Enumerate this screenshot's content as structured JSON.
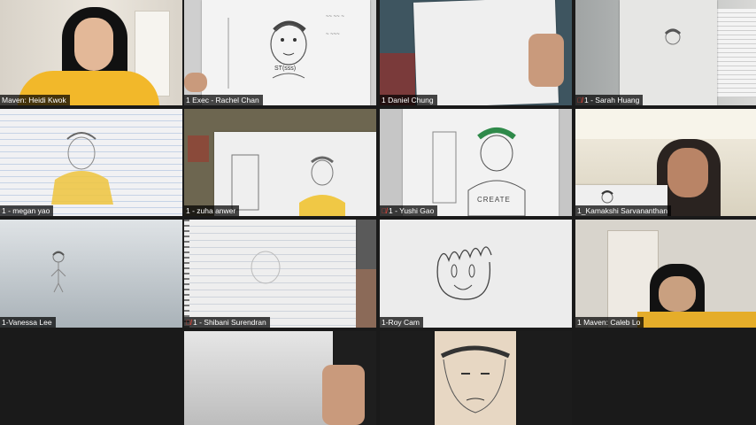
{
  "participants": [
    {
      "name": "Maven: Heidi Kwok",
      "muted": false,
      "active_speaker": true
    },
    {
      "name": "1 Exec - Rachel Chan",
      "muted": false
    },
    {
      "name": "1 Daniel Chung",
      "muted": false
    },
    {
      "name": "1 - Sarah Huang",
      "muted": true
    },
    {
      "name": "1 - megan yao",
      "muted": false
    },
    {
      "name": "1 - zuha anwer",
      "muted": false
    },
    {
      "name": "1 - Yushi Gao",
      "muted": true
    },
    {
      "name": "1_Kamakshi Sarvananthan",
      "muted": false
    },
    {
      "name": "1-Vanessa Lee",
      "muted": false
    },
    {
      "name": "1 - Shibani Surendran",
      "muted": true
    },
    {
      "name": "1-Roy Cam",
      "muted": false
    },
    {
      "name": "1 Maven: Caleb Lo",
      "muted": false
    },
    {
      "name": "",
      "muted": false
    },
    {
      "name": "",
      "muted": false
    }
  ],
  "drawing_text": {
    "rachel_caption": "ST(sss)",
    "yushi_shirt": "CREATE"
  },
  "icons": {
    "muted": "mic-off-icon"
  },
  "colors": {
    "active_border": "#c8e35a",
    "mute": "#e0463a"
  }
}
